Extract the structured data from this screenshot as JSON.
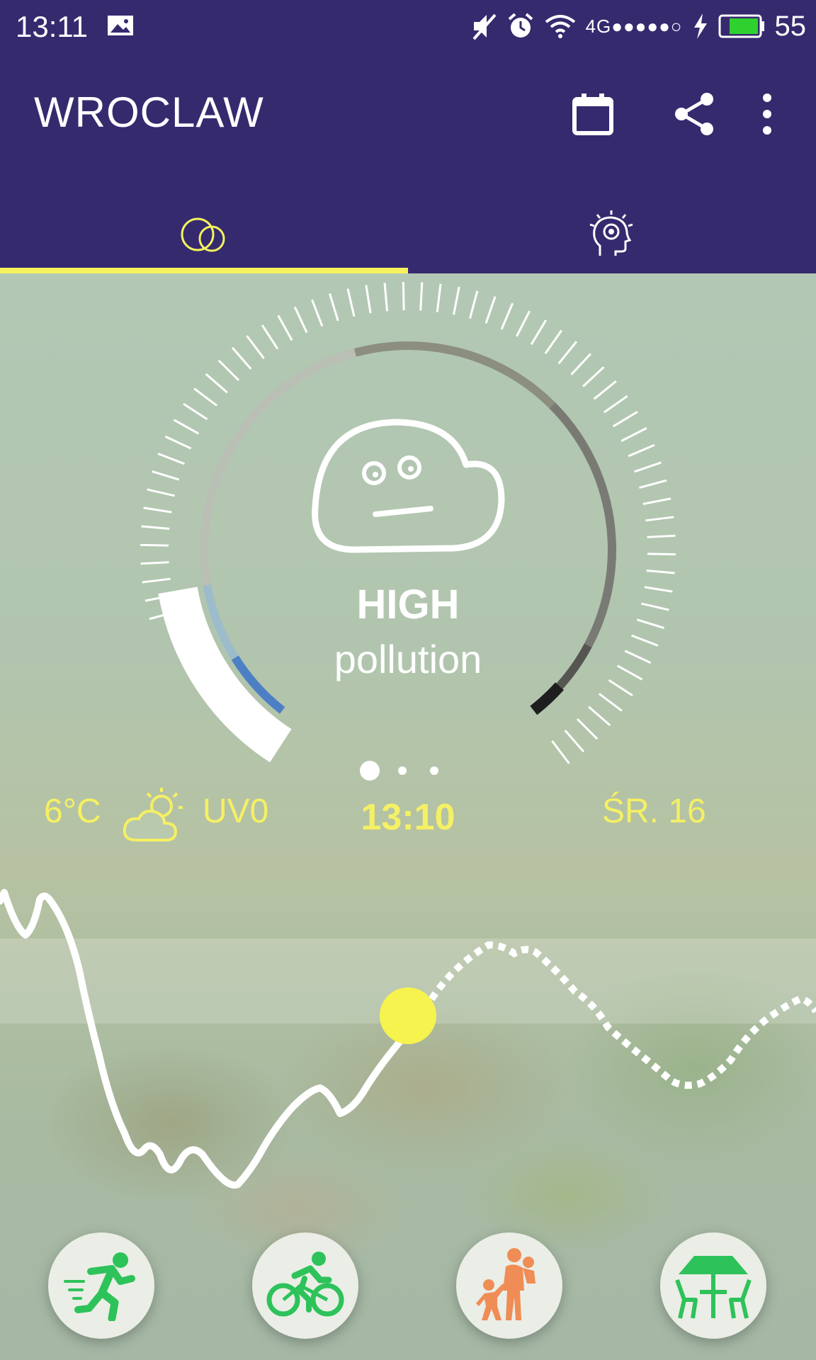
{
  "status_bar": {
    "time": "13:11",
    "network": "4G●●●●●○",
    "battery": "55"
  },
  "app_bar": {
    "title": "WROCLAW",
    "actions": [
      "calendar-icon",
      "share-icon",
      "more-vert-icon"
    ]
  },
  "tabs": [
    {
      "icon": "clouds-icon",
      "selected": true
    },
    {
      "icon": "head-idea-icon",
      "selected": false
    }
  ],
  "gauge": {
    "level": "HIGH",
    "level_sub": "pollution",
    "face_icon": "neutral-cloud-face-icon",
    "pager_pages": 3,
    "pager_selected": 0
  },
  "info": {
    "temperature": "6°C",
    "weather_icon": "sun-cloud-icon",
    "uv": "UV0",
    "time": "13:10",
    "date": "ŚR. 16"
  },
  "activities": [
    {
      "icon": "running-icon",
      "color": "#2ec25a"
    },
    {
      "icon": "cycling-icon",
      "color": "#2ec25a"
    },
    {
      "icon": "family-walk-icon",
      "color": "#f08c55"
    },
    {
      "icon": "outdoor-cafe-icon",
      "color": "#2ec25a"
    }
  ],
  "colors": {
    "primary": "#352a6e",
    "accent": "#f6f25e",
    "text_accent": "#f5f064"
  }
}
